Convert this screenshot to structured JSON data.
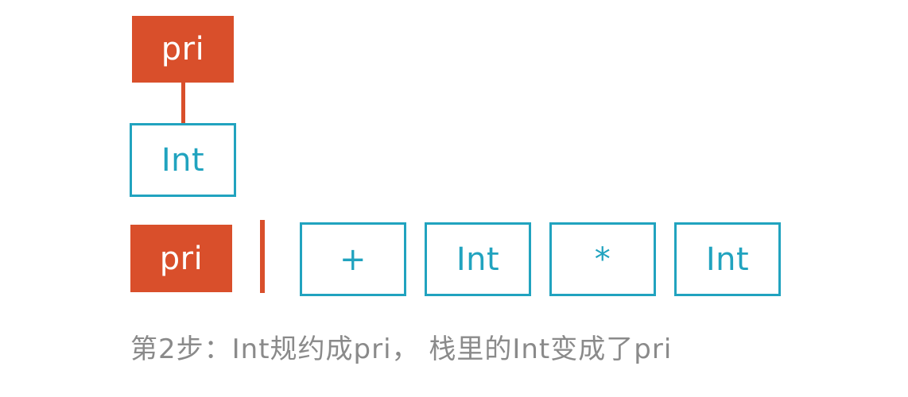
{
  "tree": {
    "parent_label": "pri",
    "child_label": "Int"
  },
  "stack": {
    "items": [
      "pri"
    ]
  },
  "input": {
    "tokens": [
      "+",
      "Int",
      "*",
      "Int"
    ]
  },
  "caption": "第2步：Int规约成pri， 栈里的Int变成了pri",
  "colors": {
    "red": "#d94f2b",
    "blue": "#21a3bf",
    "caption": "#8a8a8a"
  }
}
